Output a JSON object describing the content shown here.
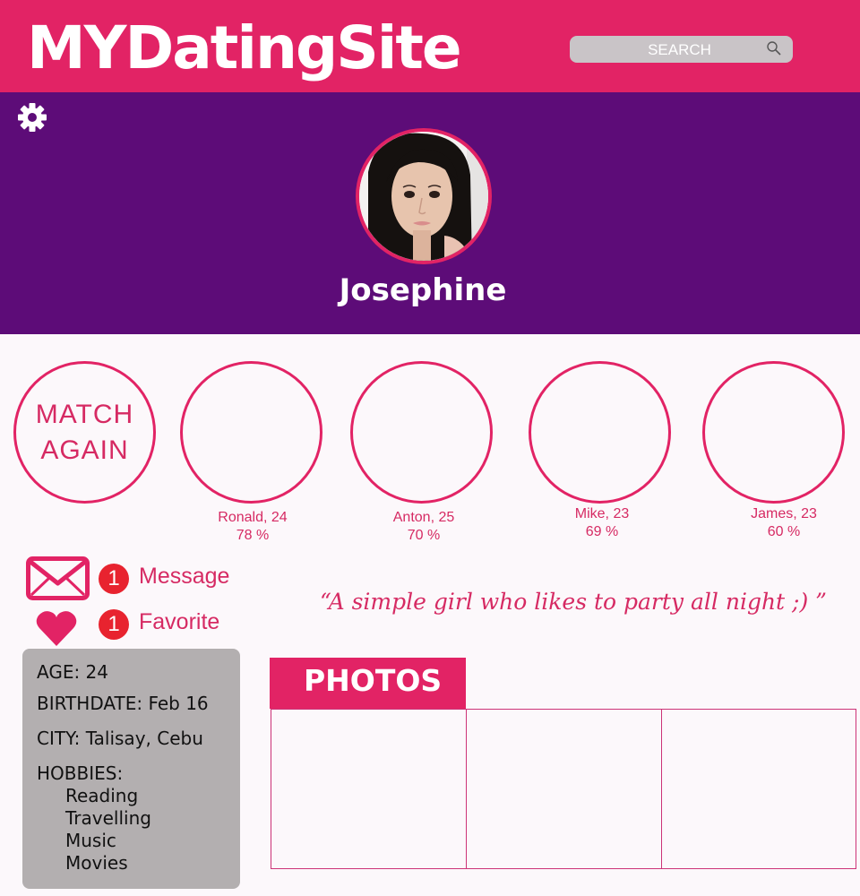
{
  "header": {
    "logo": "MYDatingSite",
    "search_placeholder": "SEARCH",
    "search_icon": "search-icon",
    "brand_color": "#e22365"
  },
  "banner": {
    "settings_icon": "gear-icon",
    "profile_name": "Josephine",
    "background_color": "#5d0c78"
  },
  "matches": {
    "match_again_label": [
      "MATCH",
      "AGAIN"
    ],
    "items": [
      {
        "name_age": "Ronald, 24",
        "percent": "78 %"
      },
      {
        "name_age": "Anton, 25",
        "percent": "70 %"
      },
      {
        "name_age": "Mike, 23",
        "percent": "69 %"
      },
      {
        "name_age": "James, 23",
        "percent": "60 %"
      }
    ]
  },
  "actions": {
    "message_count": "1",
    "message_label": "Message",
    "favorite_count": "1",
    "favorite_label": "Favorite"
  },
  "quote": "“A simple girl who likes to party all night ;) ”",
  "profile": {
    "age": "AGE: 24",
    "birthdate": "BIRTHDATE: Feb 16",
    "city": "CITY: Talisay, Cebu",
    "hobbies_title": "HOBBIES:",
    "hobbies": [
      "Reading",
      "Travelling",
      "Music",
      "Movies"
    ]
  },
  "photos": {
    "title": "PHOTOS"
  }
}
